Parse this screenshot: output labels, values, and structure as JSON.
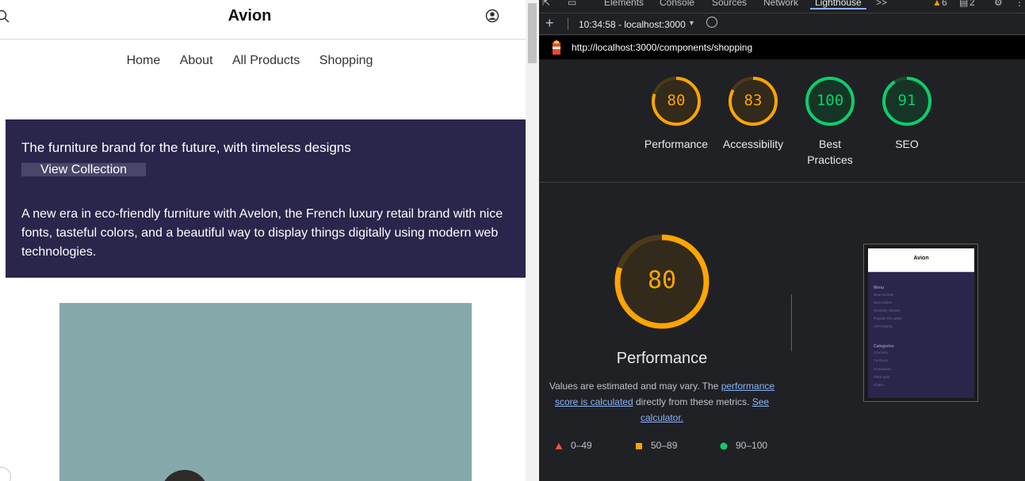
{
  "site": {
    "brand": "Avion",
    "nav": [
      "Home",
      "About",
      "All Products",
      "Shopping"
    ],
    "hero": {
      "title": "The furniture brand for the future, with timeless designs",
      "button_label": "View Collection",
      "text": "A new era in eco-friendly furniture with Avelon, the French luxury retail brand with nice fonts, tasteful colors, and a beautiful way to display things digitally using modern web technologies."
    }
  },
  "devtools": {
    "tabs": [
      "Elements",
      "Console",
      "Sources",
      "Network",
      "Lighthouse"
    ],
    "active_tab": "Lighthouse",
    "more_tabs": ">>",
    "warnings_count": "6",
    "messages_count": "2",
    "report_label": "10:34:58 - localhost:3000",
    "url": "http://localhost:3000/components/shopping",
    "scores": [
      {
        "label": "Performance",
        "value": 80,
        "color": "#ffa400"
      },
      {
        "label": "Accessibility",
        "value": 83,
        "color": "#ffa400"
      },
      {
        "label": "Best Practices",
        "value": 100,
        "color": "#0cce6b"
      },
      {
        "label": "SEO",
        "value": 91,
        "color": "#0cce6b"
      }
    ],
    "main_score": {
      "label": "Performance",
      "value": 80,
      "color": "#ffa400"
    },
    "desc": {
      "t1": "Values are estimated and may vary. The ",
      "link1": "performance score is calculated",
      "t2": " directly from these metrics. ",
      "link2": "See calculator."
    },
    "legend": [
      {
        "range": "0–49",
        "color": "#ff4e42"
      },
      {
        "range": "50–89",
        "color": "#ffa400"
      },
      {
        "range": "90–100",
        "color": "#0cce6b"
      }
    ],
    "thumbnail": {
      "brand": "Avion",
      "menu_title": "Menu",
      "menu_items": [
        "New Arrivals",
        "Best sellers",
        "Recently viewed",
        "Popular this week",
        "All Products"
      ],
      "categories_title": "Categories",
      "category_items": [
        "Crockery",
        "Furniture",
        "Homeware",
        "Plant pots",
        "Chairs"
      ]
    }
  }
}
